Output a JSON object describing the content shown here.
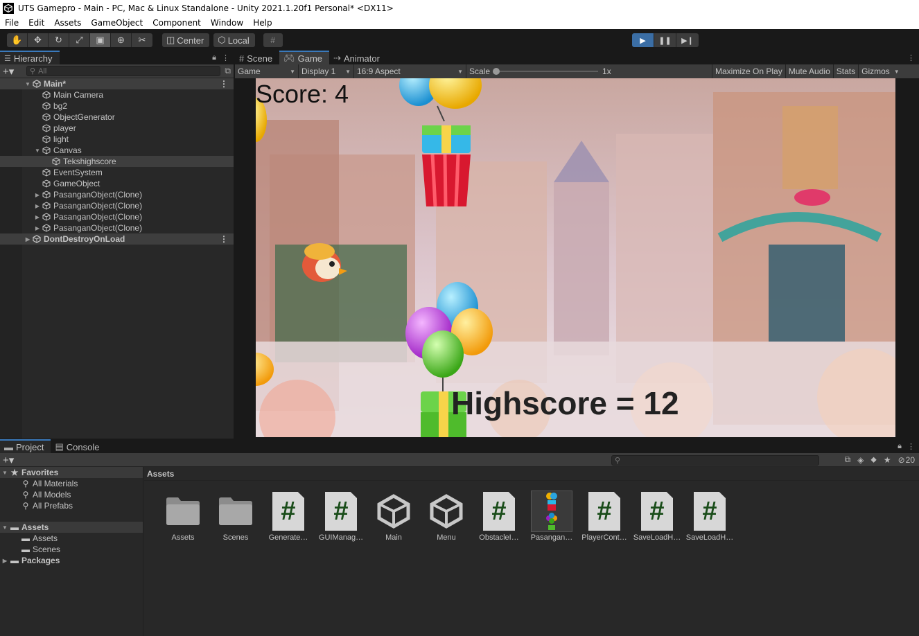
{
  "window": {
    "title": "UTS Gamepro - Main - PC, Mac & Linux Standalone - Unity 2021.1.20f1 Personal* <DX11>"
  },
  "menu": [
    "File",
    "Edit",
    "Assets",
    "GameObject",
    "Component",
    "Window",
    "Help"
  ],
  "toolbar": {
    "pivot_label": "Center",
    "space_label": "Local"
  },
  "hierarchy": {
    "tab_label": "Hierarchy",
    "search_placeholder": "All",
    "items": [
      {
        "label": "Main*",
        "depth": 0,
        "type": "scene",
        "expanded": true
      },
      {
        "label": "Main Camera",
        "depth": 1
      },
      {
        "label": "bg2",
        "depth": 1
      },
      {
        "label": "ObjectGenerator",
        "depth": 1
      },
      {
        "label": "player",
        "depth": 1
      },
      {
        "label": "light",
        "depth": 1
      },
      {
        "label": "Canvas",
        "depth": 1,
        "expanded": true
      },
      {
        "label": "Tekshighscore",
        "depth": 2,
        "selected": true
      },
      {
        "label": "EventSystem",
        "depth": 1
      },
      {
        "label": "GameObject",
        "depth": 1
      },
      {
        "label": "PasanganObject(Clone)",
        "depth": 1,
        "collapsed": true
      },
      {
        "label": "PasanganObject(Clone)",
        "depth": 1,
        "collapsed": true
      },
      {
        "label": "PasanganObject(Clone)",
        "depth": 1,
        "collapsed": true
      },
      {
        "label": "PasanganObject(Clone)",
        "depth": 1,
        "collapsed": true
      },
      {
        "label": "DontDestroyOnLoad",
        "depth": 0,
        "type": "scene",
        "collapsed": true
      }
    ]
  },
  "center_tabs": {
    "scene": "Scene",
    "game": "Game",
    "animator": "Animator"
  },
  "game_toolbar": {
    "view": "Game",
    "display": "Display 1",
    "aspect": "16:9 Aspect",
    "scale_label": "Scale",
    "scale_value": "1x",
    "scale_fraction": 0,
    "maximize": "Maximize On Play",
    "mute": "Mute Audio",
    "stats": "Stats",
    "gizmos": "Gizmos"
  },
  "game": {
    "score": "Score: 4",
    "highscore": "Highscore = 12"
  },
  "bottom_tabs": {
    "project": "Project",
    "console": "Console"
  },
  "project": {
    "hidden_count": "20",
    "favorites_label": "Favorites",
    "favorites": [
      "All Materials",
      "All Models",
      "All Prefabs"
    ],
    "assets_label": "Assets",
    "asset_folders": [
      "Assets",
      "Scenes"
    ],
    "packages_label": "Packages",
    "breadcrumb": "Assets",
    "assets": [
      {
        "label": "Assets",
        "kind": "folder"
      },
      {
        "label": "Scenes",
        "kind": "folder"
      },
      {
        "label": "Generate…",
        "kind": "script"
      },
      {
        "label": "GUIManag…",
        "kind": "script"
      },
      {
        "label": "Main",
        "kind": "scene"
      },
      {
        "label": "Menu",
        "kind": "scene"
      },
      {
        "label": "ObstacleI…",
        "kind": "script"
      },
      {
        "label": "Pasangan…",
        "kind": "prefab"
      },
      {
        "label": "PlayerCont…",
        "kind": "script"
      },
      {
        "label": "SaveLoadH…",
        "kind": "script"
      },
      {
        "label": "SaveLoadH…",
        "kind": "script"
      }
    ]
  },
  "colors": {
    "accent": "#3a79bb",
    "panel": "#282828",
    "toolbar": "#3c3c3c",
    "script_hash": "#1a4d1a"
  }
}
